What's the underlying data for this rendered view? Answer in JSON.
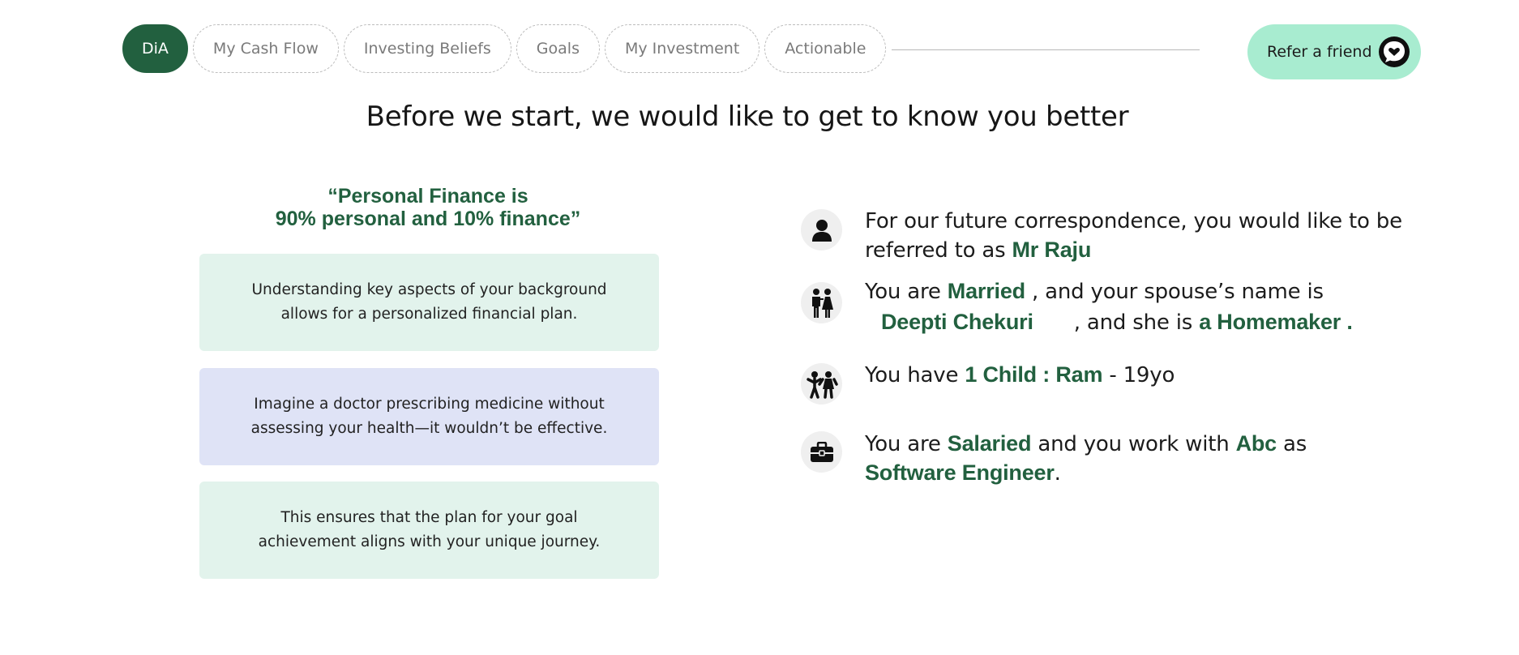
{
  "nav": {
    "tabs": [
      {
        "label": "DiA",
        "active": true
      },
      {
        "label": "My Cash Flow",
        "active": false
      },
      {
        "label": "Investing Beliefs",
        "active": false
      },
      {
        "label": "Goals",
        "active": false
      },
      {
        "label": "My Investment",
        "active": false
      },
      {
        "label": "Actionable",
        "active": false
      }
    ],
    "refer_label": "Refer a friend",
    "refer_icon": "heart-chat-icon"
  },
  "heading": "Before we start, we would like to get to know you better",
  "quote": {
    "line1": "“Personal Finance is",
    "line2": "90% personal and 10% finance”"
  },
  "cards": [
    {
      "line1": "Understanding key aspects of your background",
      "line2": "allows for a personalized financial plan."
    },
    {
      "line1": "Imagine a doctor prescribing medicine without",
      "line2": "assessing your health—it wouldn’t be effective."
    },
    {
      "line1": "This ensures that the plan for your goal",
      "line2": "achievement aligns with your unique journey."
    }
  ],
  "profile": {
    "name_row": {
      "icon": "person-icon",
      "text_a": "For our future correspondence, you would like to be",
      "text_b": "referred to as ",
      "name": "Mr Raju"
    },
    "marital_row": {
      "icon": "couple-icon",
      "text_a": "You are ",
      "status": "Married",
      "text_b": " , and your spouse’s name is",
      "spouse_name": "Deepti Chekuri",
      "text_c": ", and she is ",
      "occupation": "a Homemaker ."
    },
    "children_row": {
      "icon": "children-icon",
      "text_a": "You have ",
      "child": "1 Child : Ram",
      "text_b": " - 19yo"
    },
    "employment_row": {
      "icon": "briefcase-icon",
      "text_a": "You are ",
      "type": "Salaried",
      "text_b": " and you work with ",
      "employer": "Abc",
      "text_c": " as",
      "role": "Software Engineer",
      "text_d": "."
    }
  },
  "colors": {
    "accent": "#22603f",
    "refer_bg": "#a8ecd0",
    "card_green": "#e2f3ec",
    "card_blue": "#dfe3f6"
  }
}
